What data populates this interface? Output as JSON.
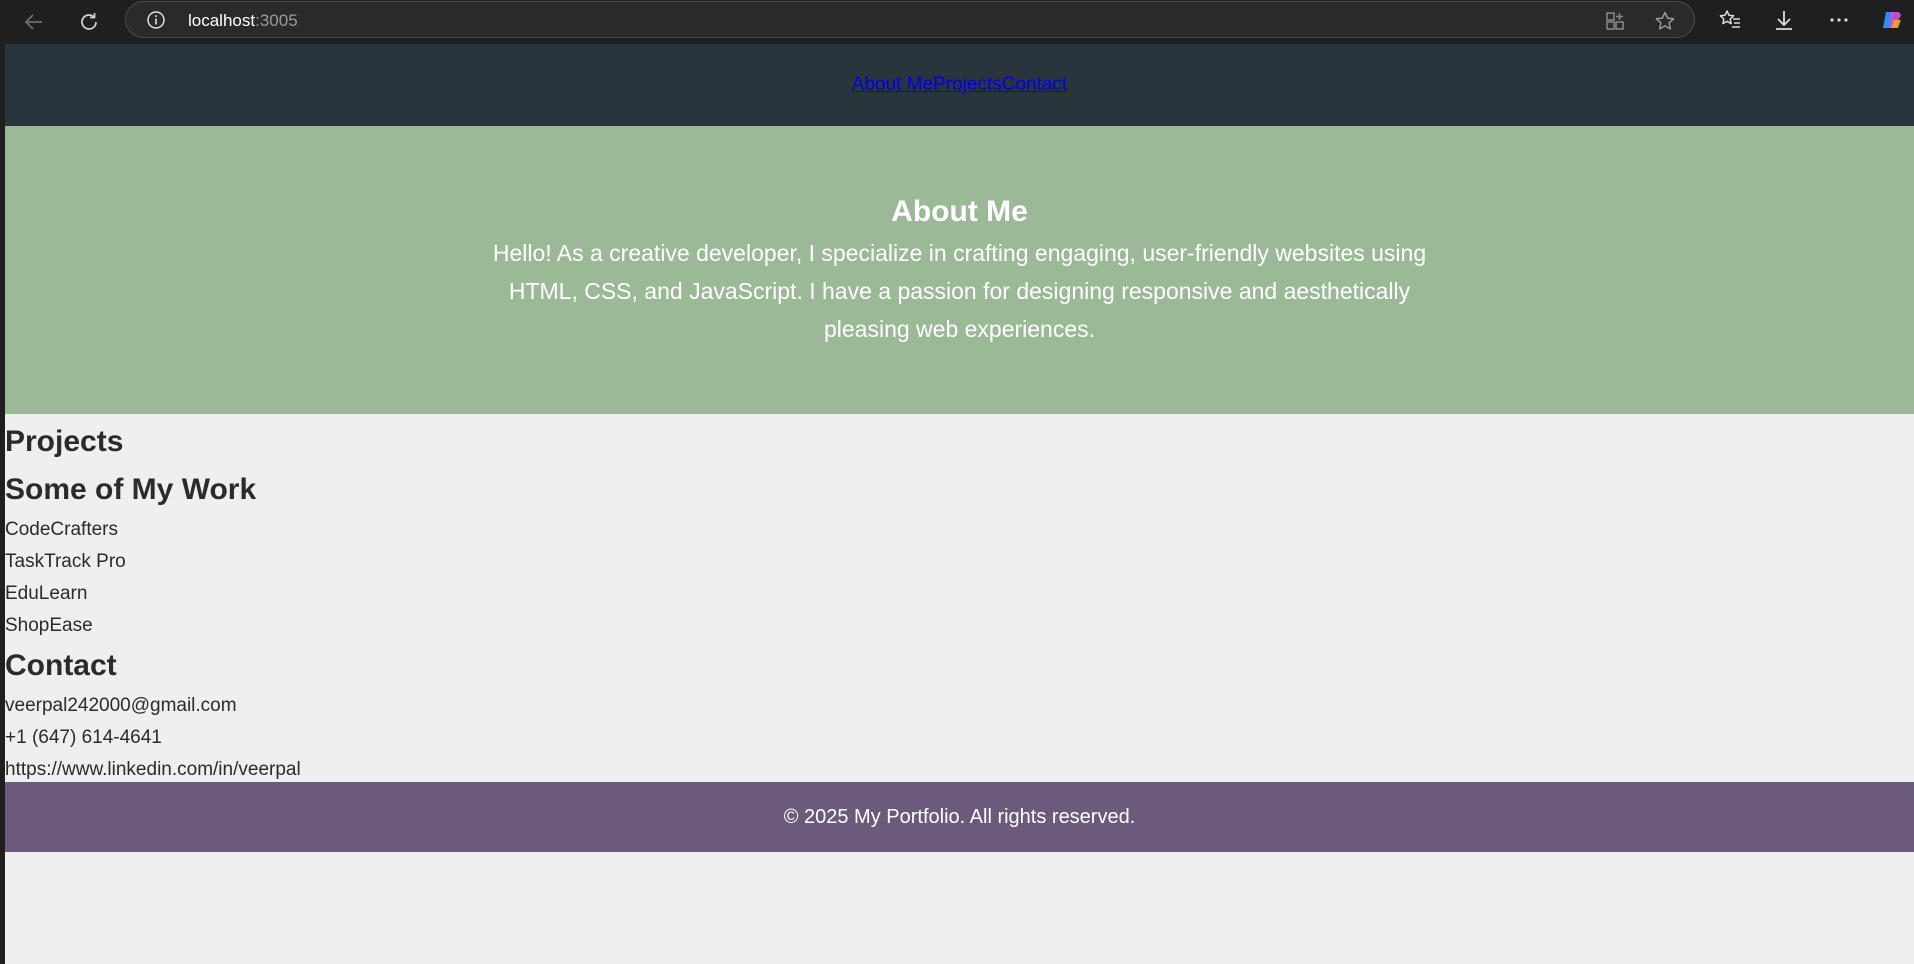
{
  "browser": {
    "url_host": "localhost",
    "url_port": ":3005"
  },
  "nav": {
    "links": [
      "About Me",
      "Projects",
      "Contact"
    ]
  },
  "about": {
    "title": "About Me",
    "text": "Hello! As a creative developer, I specialize in crafting engaging, user-friendly websites using HTML, CSS, and JavaScript. I have a passion for designing responsive and aesthetically pleasing web experiences."
  },
  "projects": {
    "title": "Projects",
    "subtitle": "Some of My Work",
    "items": [
      "CodeCrafters",
      "TaskTrack Pro",
      "EduLearn",
      "ShopEase"
    ]
  },
  "contact": {
    "title": "Contact",
    "items": [
      "veerpal242000@gmail.com",
      "+1 (647) 614-4641",
      "https://www.linkedin.com/in/veerpal"
    ]
  },
  "footer": {
    "text": "© 2025 My Portfolio. All rights reserved."
  },
  "colors": {
    "header_bg": "#2a343d",
    "about_bg": "#9bb997",
    "footer_bg": "#6b5a7a",
    "page_bg": "#efefef"
  }
}
